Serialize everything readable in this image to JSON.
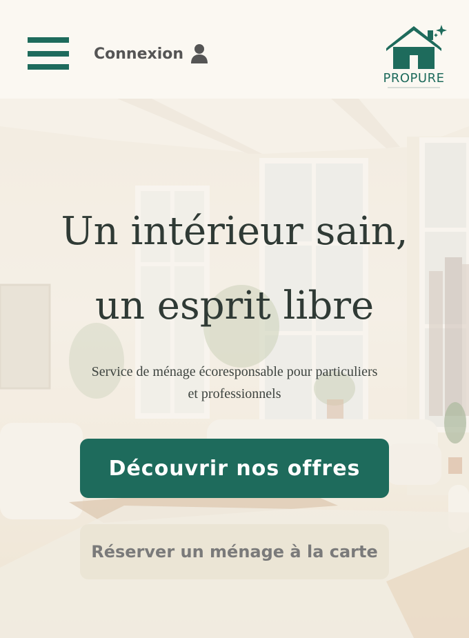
{
  "header": {
    "login_label": "Connexion",
    "menu_icon": "hamburger-menu-icon",
    "user_icon": "user-icon",
    "logo_text": "PROPURE",
    "logo_icon": "house-sparkle-icon"
  },
  "hero": {
    "title_line1": "Un intérieur sain,",
    "title_line2": "un esprit libre",
    "subtitle_line1": "Service de ménage écoresponsable pour particuliers",
    "subtitle_line2": "et professionnels",
    "primary_cta": "Découvrir nos offres",
    "secondary_cta": "Réserver un ménage à la carte"
  },
  "colors": {
    "brand": "#1e6b5c",
    "header_bg": "#fbf8f2",
    "secondary_button_bg": "#ebe5d5"
  }
}
